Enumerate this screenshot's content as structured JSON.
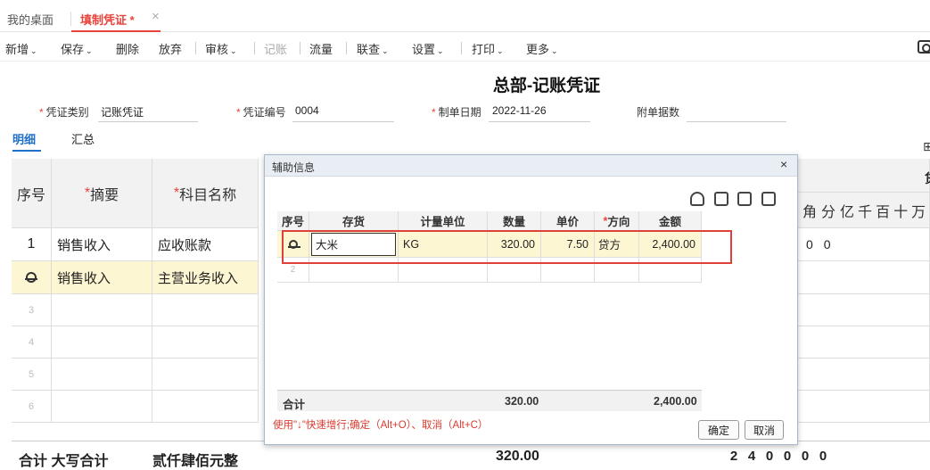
{
  "tabs": [
    {
      "label": "我的桌面"
    },
    {
      "label": "填制凭证 *"
    }
  ],
  "tab_close": "×",
  "toolbar": {
    "items": [
      {
        "label": "新增",
        "caret": "v"
      },
      {
        "label": "保存",
        "caret": "v"
      },
      {
        "label": "删除"
      },
      {
        "label": "放弃"
      },
      {
        "label": "审核",
        "caret": "v"
      },
      {
        "label": "记账"
      },
      {
        "label": "流量"
      },
      {
        "label": "联查",
        "caret": "v"
      },
      {
        "label": "设置",
        "caret": "v"
      },
      {
        "label": "打印",
        "caret": "v"
      },
      {
        "label": "更多",
        "caret": "v"
      }
    ]
  },
  "voucher": {
    "title": "总部-记账凭证",
    "category_label": "凭证类别",
    "category_value": "记账凭证",
    "number_label": "凭证编号",
    "number_value": "0004",
    "date_label": "制单日期",
    "date_value": "2022-11-26",
    "attach_label": "附单据数",
    "attach_value": ""
  },
  "subtabs": {
    "detail": "明细",
    "summary": "汇总"
  },
  "grid": {
    "headers": {
      "seq": "序号",
      "summary": "摘要",
      "account": "科目名称"
    },
    "amount_headers": [
      "角",
      "分",
      "亿",
      "千",
      "百",
      "十",
      "万"
    ],
    "right_header_fragment": "贷",
    "rows": [
      {
        "seq": "1",
        "summary": "销售收入",
        "account": "应收账款",
        "d1": "0",
        "d2": "0"
      },
      {
        "seq": "",
        "summary": "销售收入",
        "account": "主营业务收入"
      },
      {
        "seq": "3"
      },
      {
        "seq": "4"
      },
      {
        "seq": "5"
      },
      {
        "seq": "6"
      }
    ],
    "total_label": "合计 大写合计",
    "total_upper": "贰仟肆佰元整",
    "total_qty": "320.00",
    "total_digits": [
      "2",
      "4",
      "0",
      "0",
      "0",
      "0"
    ]
  },
  "dialog": {
    "title": "辅助信息",
    "close": "×",
    "headers": [
      "序号",
      "存货",
      "计量单位",
      "数量",
      "单价",
      "方向",
      "金额"
    ],
    "direction_required": "*",
    "rows": [
      {
        "seq": "",
        "item": "大米",
        "unit": "KG",
        "qty": "320.00",
        "price": "7.50",
        "dir": "贷方",
        "amount": "2,400.00"
      },
      {
        "seq": "2",
        "item": "",
        "unit": "",
        "qty": "",
        "price": "",
        "dir": "",
        "amount": ""
      }
    ],
    "sum_label": "合计",
    "sum_qty": "320.00",
    "sum_amount": "2,400.00",
    "tip": "使用\"↓\"快速增行;确定（Alt+O）、取消（Alt+C）",
    "ok": "确定",
    "cancel": "取消"
  }
}
